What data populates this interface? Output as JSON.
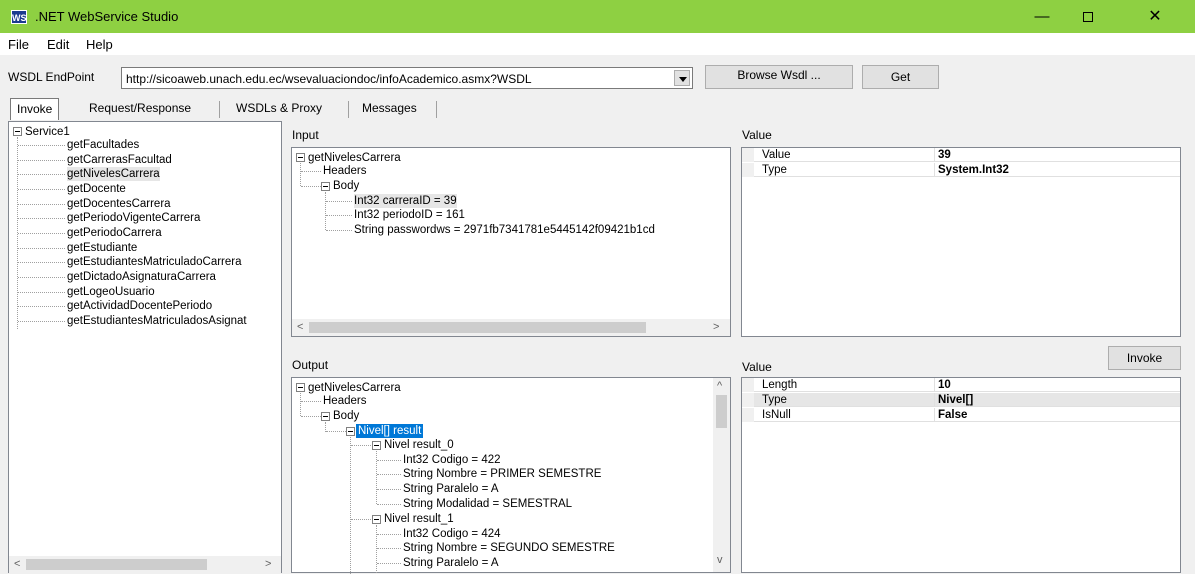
{
  "window": {
    "title": ".NET WebService Studio",
    "icon_text": "WS",
    "controls": {
      "minimize": "—",
      "close": "✕"
    }
  },
  "menu": {
    "items": [
      "File",
      "Edit",
      "Help"
    ]
  },
  "wsdl": {
    "label": "WSDL EndPoint",
    "value": "http://sicoaweb.unach.edu.ec/wsevaluaciondoc/infoAcademico.asmx?WSDL",
    "browse_label": "Browse Wsdl ...",
    "get_label": "Get"
  },
  "tabs": [
    "Invoke",
    "Request/Response",
    "WSDLs & Proxy",
    "Messages"
  ],
  "service_tree": {
    "root": "Service1",
    "methods": [
      "getFacultades",
      "getCarrerasFacultad",
      "getNivelesCarrera",
      "getDocente",
      "getDocentesCarrera",
      "getPeriodoVigenteCarrera",
      "getPeriodoCarrera",
      "getEstudiante",
      "getEstudiantesMatriculadoCarrera",
      "getDictadoAsignaturaCarrera",
      "getLogeoUsuario",
      "getActividadDocentePeriodo",
      "getEstudiantesMatriculadosAsignat"
    ],
    "selected_index": 2
  },
  "input": {
    "label": "Input",
    "method": "getNivelesCarrera",
    "headers": "Headers",
    "body": "Body",
    "params": [
      "Int32 carreraID = 39",
      "Int32 periodoID = 161",
      "String passwordws = 2971fb7341781e5445142f09421b1cd"
    ]
  },
  "input_value": {
    "label": "Value",
    "rows": [
      {
        "key": "Value",
        "value": "39"
      },
      {
        "key": "Type",
        "value": "System.Int32"
      }
    ]
  },
  "invoke_label": "Invoke",
  "output": {
    "label": "Output",
    "method": "getNivelesCarrera",
    "headers": "Headers",
    "body": "Body",
    "result": "Nivel[] result",
    "item0": "Nivel result_0",
    "item0_fields": [
      "Int32 Codigo = 422",
      "String Nombre = PRIMER SEMESTRE",
      "String Paralelo = A",
      "String Modalidad = SEMESTRAL"
    ],
    "item1": "Nivel result_1",
    "item1_fields": [
      "Int32 Codigo = 424",
      "String Nombre = SEGUNDO SEMESTRE",
      "String Paralelo = A"
    ]
  },
  "output_value": {
    "label": "Value",
    "rows": [
      {
        "key": "Length",
        "value": "10"
      },
      {
        "key": "Type",
        "value": "Nivel[]"
      },
      {
        "key": "IsNull",
        "value": "False"
      }
    ]
  },
  "scroll": {
    "left": "<",
    "right": ">",
    "up": "^",
    "down": "v"
  }
}
